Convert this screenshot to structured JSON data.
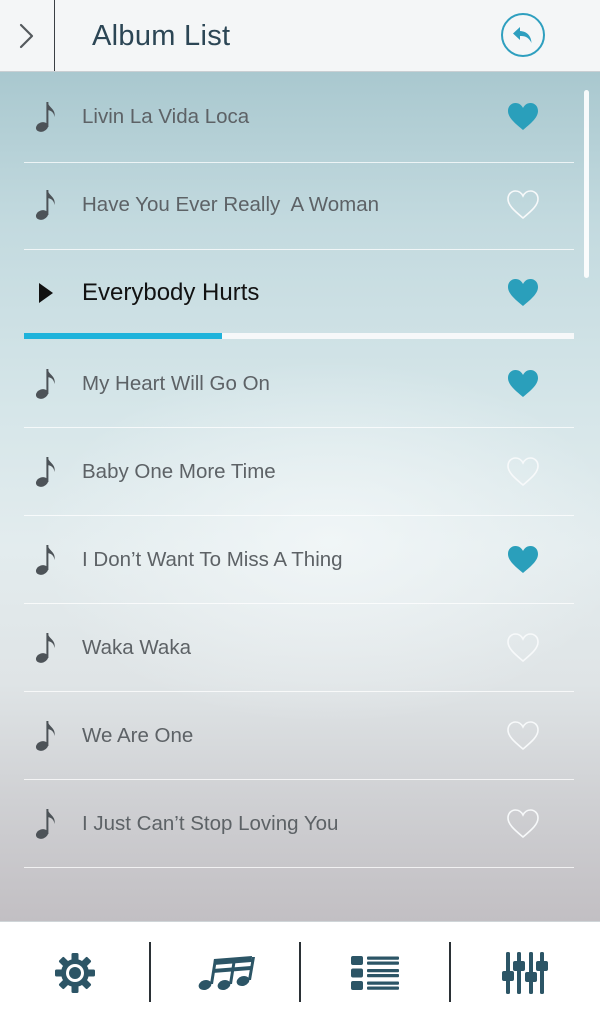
{
  "header": {
    "title": "Album List"
  },
  "colors": {
    "accent": "#1fb3db",
    "heart_filled": "#2a9fbb",
    "title_text": "#2c4655",
    "toolbar_icon": "#2c5566"
  },
  "songs": [
    {
      "title": "Livin La Vida Loca",
      "favorite": true,
      "playing": false
    },
    {
      "title": "Have You Ever Really  A Woman",
      "favorite": false,
      "playing": false
    },
    {
      "title": "Everybody Hurts",
      "favorite": true,
      "playing": true
    },
    {
      "title": "My Heart Will Go On",
      "favorite": true,
      "playing": false
    },
    {
      "title": "Baby One More Time",
      "favorite": false,
      "playing": false
    },
    {
      "title": "I Don’t Want To Miss A Thing",
      "favorite": true,
      "playing": false
    },
    {
      "title": "Waka Waka",
      "favorite": false,
      "playing": false
    },
    {
      "title": "We Are One",
      "favorite": false,
      "playing": false
    },
    {
      "title": "I Just Can’t Stop Loving You",
      "favorite": false,
      "playing": false
    }
  ],
  "playback": {
    "progress_fraction": 0.36
  },
  "toolbar": {
    "items": [
      {
        "icon": "gear-icon"
      },
      {
        "icon": "music-notes-icon"
      },
      {
        "icon": "list-icon"
      },
      {
        "icon": "equalizer-icon"
      }
    ]
  }
}
